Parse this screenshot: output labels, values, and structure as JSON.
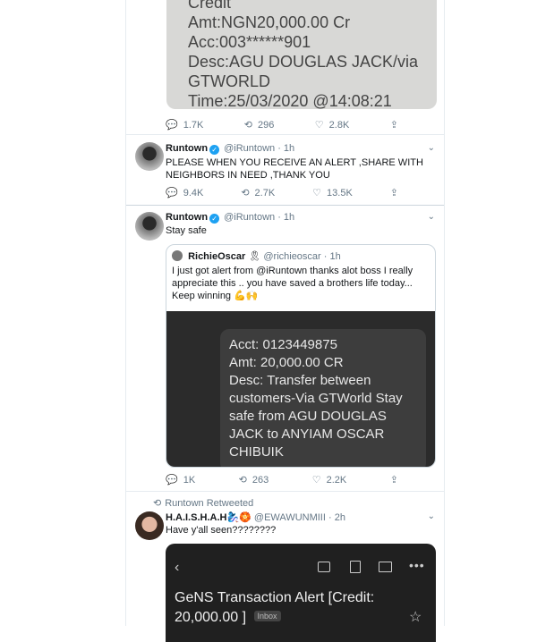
{
  "tweets": [
    {
      "image_text": [
        "Credit",
        "Amt:NGN20,000.00 Cr",
        "Acc:003******901",
        "Desc:AGU  DOUGLAS JACK/via",
        "GTWORLD",
        "Time:25/03/2020 @14:08:21"
      ],
      "stats": {
        "reply": "1.7K",
        "retweet": "296",
        "like": "2.8K"
      }
    },
    {
      "name": "Runtown",
      "handle": "@iRuntown",
      "time": "· 1h",
      "text": "PLEASE WHEN YOU RECEIVE AN ALERT ,SHARE WITH NEIGHBORS IN NEED ,THANK YOU",
      "stats": {
        "reply": "9.4K",
        "retweet": "2.7K",
        "like": "13.5K"
      }
    },
    {
      "name": "Runtown",
      "handle": "@iRuntown",
      "time": "· 1h",
      "text": "Stay safe",
      "quote": {
        "name": "RichieOscar",
        "emoji": "🎗",
        "handle": "@richieoscar",
        "time": "· 1h",
        "text": "I just got alert from @iRuntown thanks alot boss I really appreciate this .. you have saved a brothers life today... Keep winning 💪🙌",
        "image_text": [
          "Acct: 0123449875",
          "Amt: 20,000.00 CR",
          "Desc: Transfer between",
          "customers-Via GTWorld Stay",
          "safe from AGU DOUGLAS",
          "JACK to ANYIAM OSCAR",
          "CHIBUIK"
        ]
      },
      "stats": {
        "reply": "1K",
        "retweet": "263",
        "like": "2.2K"
      }
    },
    {
      "retweeted_by": "Runtown Retweeted",
      "name": "H.A.I.S.H.A.H🧞‍♀️🏵️",
      "handle": "@EWAWUNMIII",
      "time": "· 2h",
      "text": "Have y'all seen????????",
      "image": {
        "subject": "GeNS Transaction Alert [Credit:",
        "subject2": "20,000.00 ]",
        "badge": "Inbox"
      }
    }
  ],
  "colors": {
    "accent": "#1da1f2",
    "muted": "#657786",
    "border": "#e6ecf0"
  }
}
